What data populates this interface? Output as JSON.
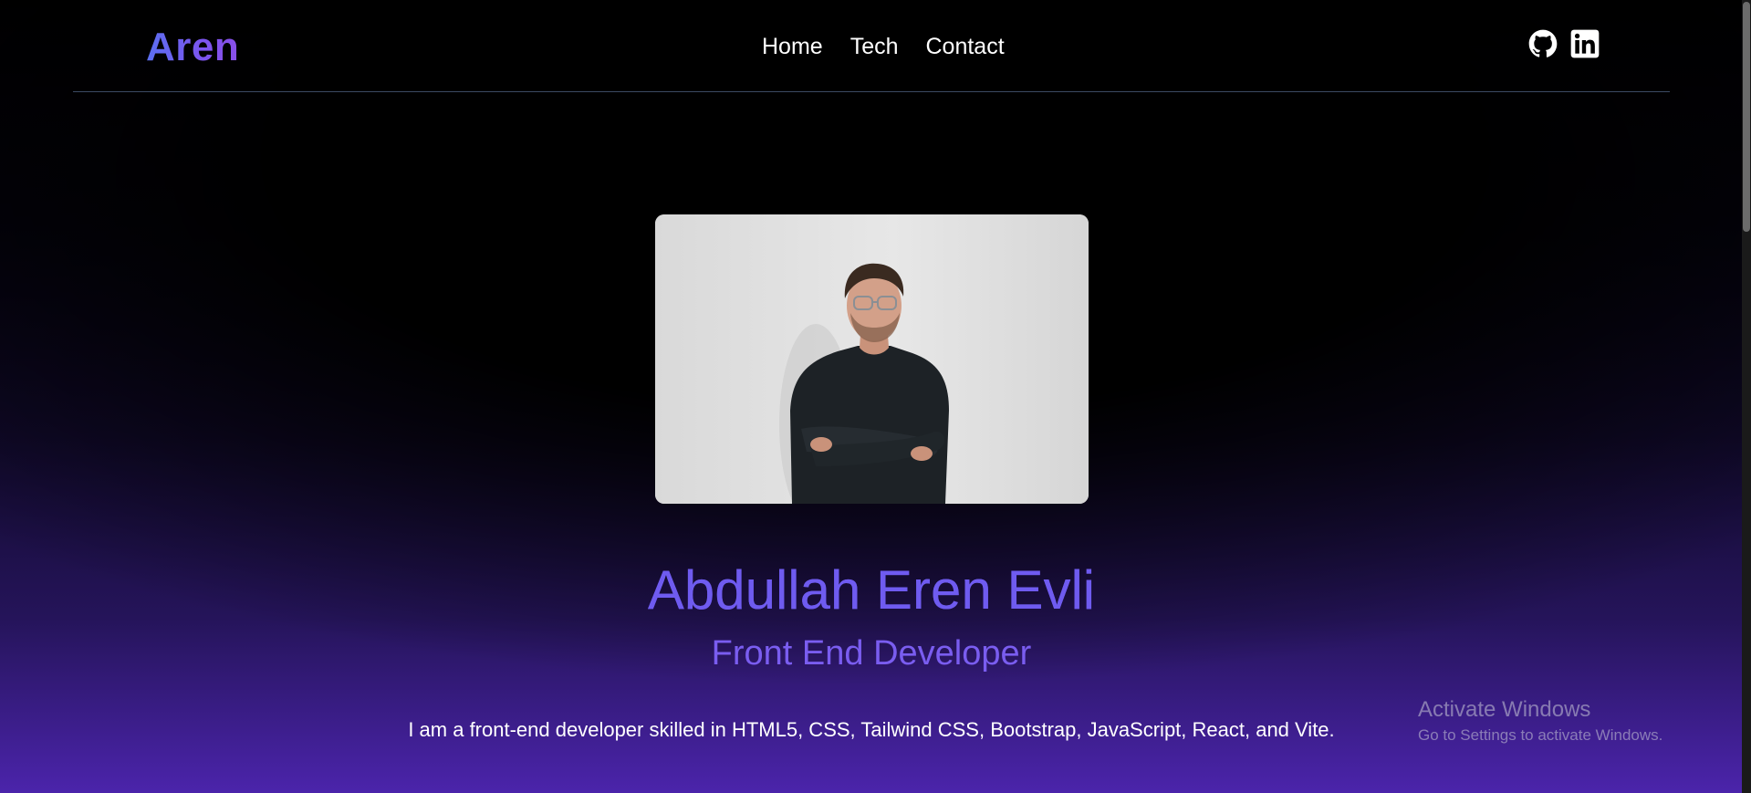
{
  "header": {
    "logo": "Aren",
    "nav": [
      {
        "label": "Home"
      },
      {
        "label": "Tech"
      },
      {
        "label": "Contact"
      }
    ],
    "socials": [
      {
        "icon": "github-icon"
      },
      {
        "icon": "linkedin-icon"
      }
    ]
  },
  "hero": {
    "photo_icon": "profile-photo",
    "name": "Abdullah Eren Evli",
    "role": "Front End Developer",
    "bio": "I am a front-end developer skilled in HTML5, CSS, Tailwind CSS, Bootstrap, JavaScript, React, and Vite."
  },
  "watermark": {
    "title": "Activate Windows",
    "subtitle": "Go to Settings to activate Windows."
  },
  "colors": {
    "accent": "#6f5bf0",
    "background_bottom": "#4b24ab",
    "divider": "#3b4a63"
  }
}
